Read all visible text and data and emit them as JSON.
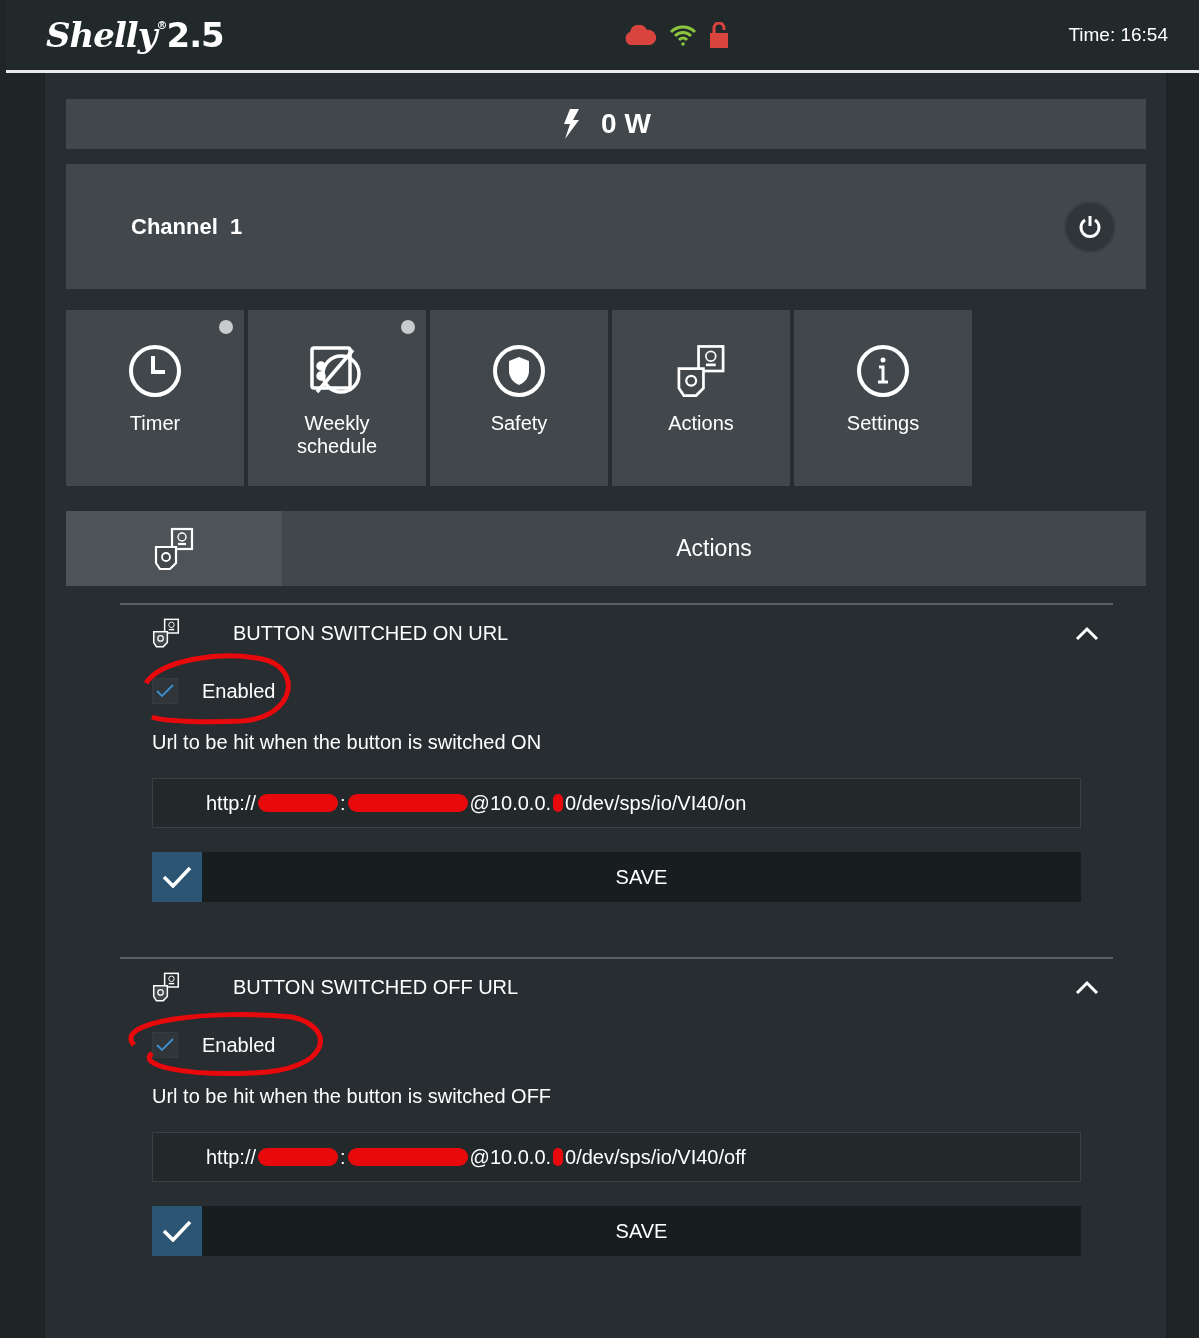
{
  "header": {
    "logo": {
      "name": "Shelly",
      "mark": "®",
      "model": "2.5"
    },
    "time": "Time: 16:54"
  },
  "power": {
    "reading": "0 W"
  },
  "channel": {
    "title": "Channel  1",
    "on": false
  },
  "tiles": [
    {
      "kind": "timer",
      "label": "Timer",
      "dot": true
    },
    {
      "kind": "schedule",
      "label": "Weekly schedule",
      "dot": true
    },
    {
      "kind": "safety",
      "label": "Safety",
      "dot": false
    },
    {
      "kind": "actions",
      "label": "Actions",
      "dot": false
    },
    {
      "kind": "settings",
      "label": "Settings",
      "dot": false
    }
  ],
  "panel": {
    "title": "Actions"
  },
  "sections": [
    {
      "title": "BUTTON SWITCHED ON URL",
      "expanded": true,
      "enabled": {
        "label": "Enabled",
        "checked": true
      },
      "description": "Url to be hit when the button is switched ON",
      "url_parts": [
        "http://",
        ":",
        "@10.0.0.",
        "0/dev/sps/io/VI40/on"
      ],
      "save": "SAVE"
    },
    {
      "title": "BUTTON SWITCHED OFF URL",
      "expanded": true,
      "enabled": {
        "label": "Enabled",
        "checked": true
      },
      "description": "Url to be hit when the button is switched OFF",
      "url_parts": [
        "http://",
        ":",
        "@10.0.0.",
        "0/dev/sps/io/VI40/off"
      ],
      "save": "SAVE"
    }
  ]
}
